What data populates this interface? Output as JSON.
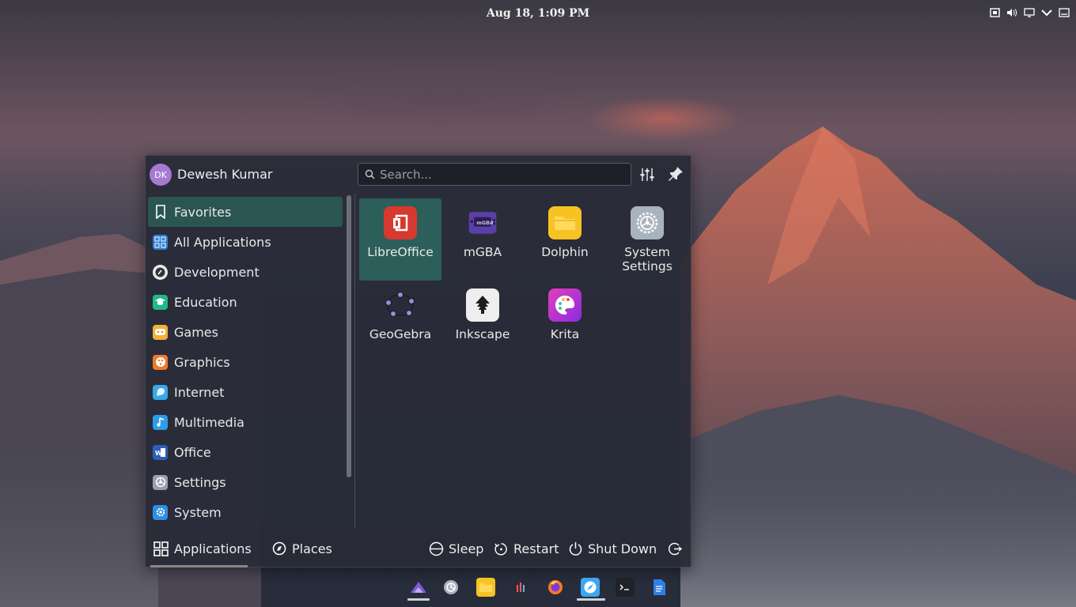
{
  "panel": {
    "clock": "Aug 18, 1:09 PM",
    "tray_icons": [
      "screenshot-icon",
      "volume-icon",
      "display-icon",
      "chevron-down-icon",
      "window-icon"
    ]
  },
  "launcher": {
    "user": {
      "initials": "DK",
      "name": "Dewesh Kumar"
    },
    "search": {
      "placeholder": "Search..."
    },
    "categories": [
      {
        "label": "Favorites",
        "icon": "bookmark-icon",
        "active": true
      },
      {
        "label": "All Applications",
        "icon": "grid-icon"
      },
      {
        "label": "Development",
        "icon": "development-icon"
      },
      {
        "label": "Education",
        "icon": "education-icon"
      },
      {
        "label": "Games",
        "icon": "games-icon"
      },
      {
        "label": "Graphics",
        "icon": "graphics-icon"
      },
      {
        "label": "Internet",
        "icon": "internet-icon"
      },
      {
        "label": "Multimedia",
        "icon": "multimedia-icon"
      },
      {
        "label": "Office",
        "icon": "office-icon"
      },
      {
        "label": "Settings",
        "icon": "settings-icon"
      },
      {
        "label": "System",
        "icon": "system-icon"
      }
    ],
    "apps": [
      {
        "label": "LibreOffice",
        "icon": "libreoffice-icon",
        "active": true
      },
      {
        "label": "mGBA",
        "icon": "mgba-icon"
      },
      {
        "label": "Dolphin",
        "icon": "folder-icon"
      },
      {
        "label": "System\nSettings",
        "icon": "system-settings-icon"
      },
      {
        "label": "GeoGebra",
        "icon": "geogebra-icon"
      },
      {
        "label": "Inkscape",
        "icon": "inkscape-icon"
      },
      {
        "label": "Krita",
        "icon": "krita-icon"
      }
    ],
    "footer": {
      "tabs": [
        {
          "label": "Applications",
          "icon": "apps-grid-icon",
          "active": true
        },
        {
          "label": "Places",
          "icon": "compass-icon"
        }
      ],
      "power": [
        {
          "label": "Sleep",
          "icon": "sleep-icon"
        },
        {
          "label": "Restart",
          "icon": "restart-icon"
        },
        {
          "label": "Shut Down",
          "icon": "power-icon"
        }
      ],
      "leave_icon": "leave-icon"
    }
  },
  "dock": {
    "items": [
      "kde-launcher-icon",
      "discover-icon",
      "files-icon",
      "system-monitor-icon",
      "firefox-icon",
      "safari-icon",
      "terminal-icon",
      "document-icon"
    ],
    "running": [
      "kde-launcher-icon",
      "safari-icon"
    ]
  },
  "colors": {
    "accent": "#2c5f59",
    "panel_bg": "#282a37",
    "avatar": "#a67ad0"
  }
}
